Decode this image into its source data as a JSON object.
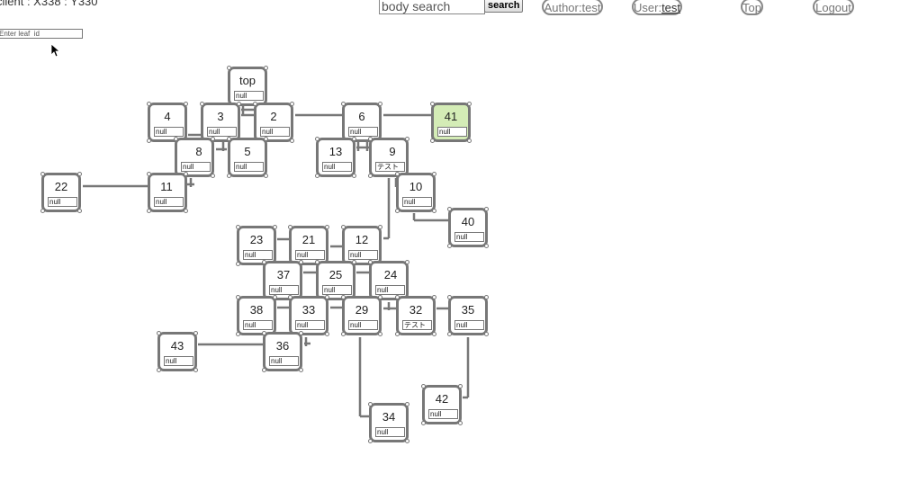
{
  "status": {
    "coords": "client : X338 : Y330"
  },
  "leaf_input": {
    "placeholder": "Enter leaf  id"
  },
  "search": {
    "placeholder": "body search",
    "button_label": "search"
  },
  "nav": {
    "author": "Author:test",
    "user_prefix": "User:",
    "user_name": "test",
    "top": "Top",
    "logout": "Logout"
  },
  "colors": {
    "selected": "#d4ecb6",
    "border": "#777777"
  },
  "nodes": [
    {
      "id": "top",
      "label": "top",
      "value": "null"
    },
    {
      "id": "4",
      "label": "4",
      "value": "null"
    },
    {
      "id": "3",
      "label": "3",
      "value": "null"
    },
    {
      "id": "2",
      "label": "2",
      "value": "null"
    },
    {
      "id": "6",
      "label": "6",
      "value": "null"
    },
    {
      "id": "41",
      "label": "41",
      "value": "null",
      "selected": true
    },
    {
      "id": "8",
      "label": "8",
      "value": "null"
    },
    {
      "id": "5",
      "label": "5",
      "value": "null"
    },
    {
      "id": "13",
      "label": "13",
      "value": "null"
    },
    {
      "id": "9",
      "label": "9",
      "value": "テスト"
    },
    {
      "id": "22",
      "label": "22",
      "value": "null"
    },
    {
      "id": "11",
      "label": "11",
      "value": "null"
    },
    {
      "id": "10",
      "label": "10",
      "value": "null"
    },
    {
      "id": "40",
      "label": "40",
      "value": "null"
    },
    {
      "id": "23",
      "label": "23",
      "value": "null"
    },
    {
      "id": "21",
      "label": "21",
      "value": "null"
    },
    {
      "id": "12",
      "label": "12",
      "value": "null"
    },
    {
      "id": "37",
      "label": "37",
      "value": "null"
    },
    {
      "id": "25",
      "label": "25",
      "value": "null"
    },
    {
      "id": "24",
      "label": "24",
      "value": "null"
    },
    {
      "id": "38",
      "label": "38",
      "value": "null"
    },
    {
      "id": "33",
      "label": "33",
      "value": "null"
    },
    {
      "id": "29",
      "label": "29",
      "value": "null"
    },
    {
      "id": "32",
      "label": "32",
      "value": "テスト"
    },
    {
      "id": "35",
      "label": "35",
      "value": "null"
    },
    {
      "id": "43",
      "label": "43",
      "value": "null"
    },
    {
      "id": "36",
      "label": "36",
      "value": "null"
    },
    {
      "id": "42",
      "label": "42",
      "value": "null"
    },
    {
      "id": "34",
      "label": "34",
      "value": "null"
    }
  ]
}
